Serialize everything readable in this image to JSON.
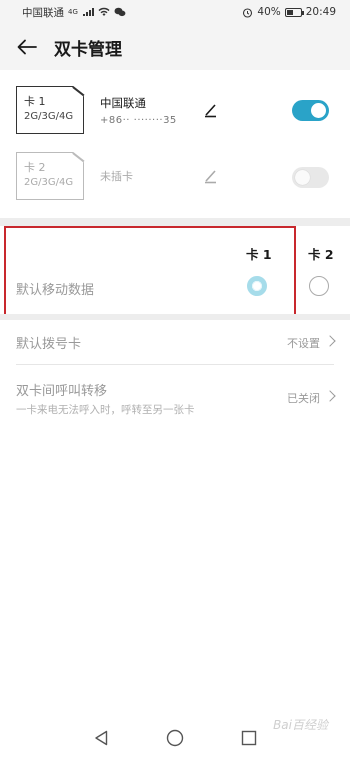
{
  "status_bar": {
    "carrier": "中国联通",
    "network": "4G",
    "battery": "40%",
    "time": "20:49"
  },
  "header": {
    "title": "双卡管理"
  },
  "sims": [
    {
      "name": "卡 1",
      "net": "2G/3G/4G",
      "carrier": "中国联通",
      "number": "+86·· ········35",
      "enabled": true
    },
    {
      "name": "卡 2",
      "net": "2G/3G/4G",
      "status": "未插卡",
      "enabled": false
    }
  ],
  "mobile_data": {
    "col1": "卡 1",
    "col2": "卡 2",
    "label": "默认移动数据",
    "selected": "卡 1"
  },
  "default_dial": {
    "label": "默认拨号卡",
    "value": "不设置"
  },
  "call_forward": {
    "label": "双卡间呼叫转移",
    "subtitle": "一卡来电无法呼入时，呼转至另一张卡",
    "value": "已关闭"
  },
  "watermark": "Bai百经验",
  "colors": {
    "accent": "#2aa3c8",
    "highlight": "#c8282d"
  }
}
